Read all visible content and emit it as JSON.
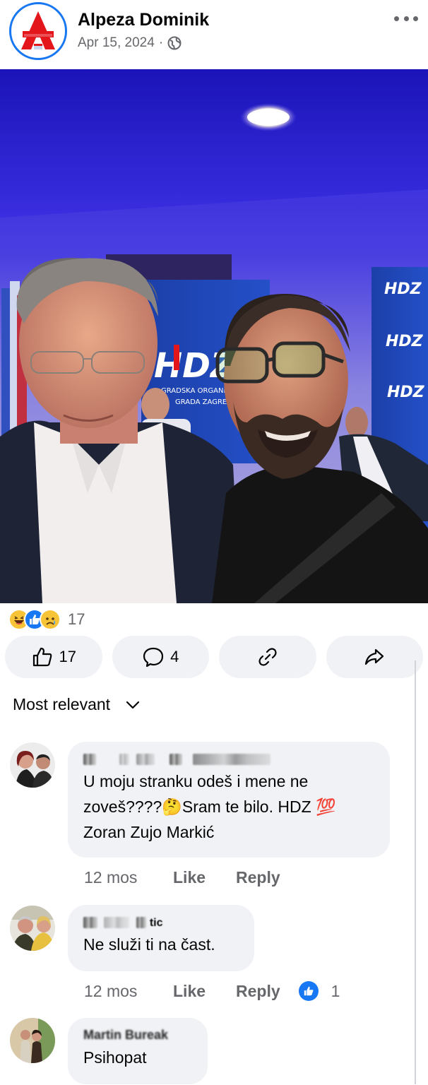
{
  "post": {
    "author": "Alpeza Dominik",
    "date": "Apr 15, 2024",
    "separator": "·",
    "privacy_icon": "globe-icon",
    "more_icon": "more-options-icon"
  },
  "photo": {
    "banner_text_main": "HDZ",
    "banner_text_line1": "GRADSKA ORGANIZ",
    "banner_text_line2": "GRADA ZAGREB",
    "side_banner_text": "HDZ"
  },
  "reactions": {
    "icons": [
      "haha-icon",
      "like-icon",
      "sad-icon"
    ],
    "count": "17"
  },
  "actions": {
    "like_count": "17",
    "comment_count": "4",
    "link_icon": "link-icon",
    "share_icon": "share-icon"
  },
  "sort": {
    "label": "Most relevant"
  },
  "comments": [
    {
      "text_line1": "U moju stranku odeš i mene ne",
      "text_line2": "zoveš????🤔Sram te bilo. HDZ 💯",
      "text_line3": "Zoran Zujo Markić",
      "time": "12 mos",
      "like": "Like",
      "reply": "Reply"
    },
    {
      "name_partial": "tic",
      "text_line1": "Ne služi ti na čast.",
      "time": "12 mos",
      "like": "Like",
      "reply": "Reply",
      "like_count": "1"
    },
    {
      "name_partial": "Martin Bureak",
      "text_line1": "Psihopat"
    }
  ],
  "colors": {
    "accent": "#1877f2",
    "logo_red": "#e3161c",
    "bubble": "#f0f2f5",
    "muted": "#65676b"
  }
}
